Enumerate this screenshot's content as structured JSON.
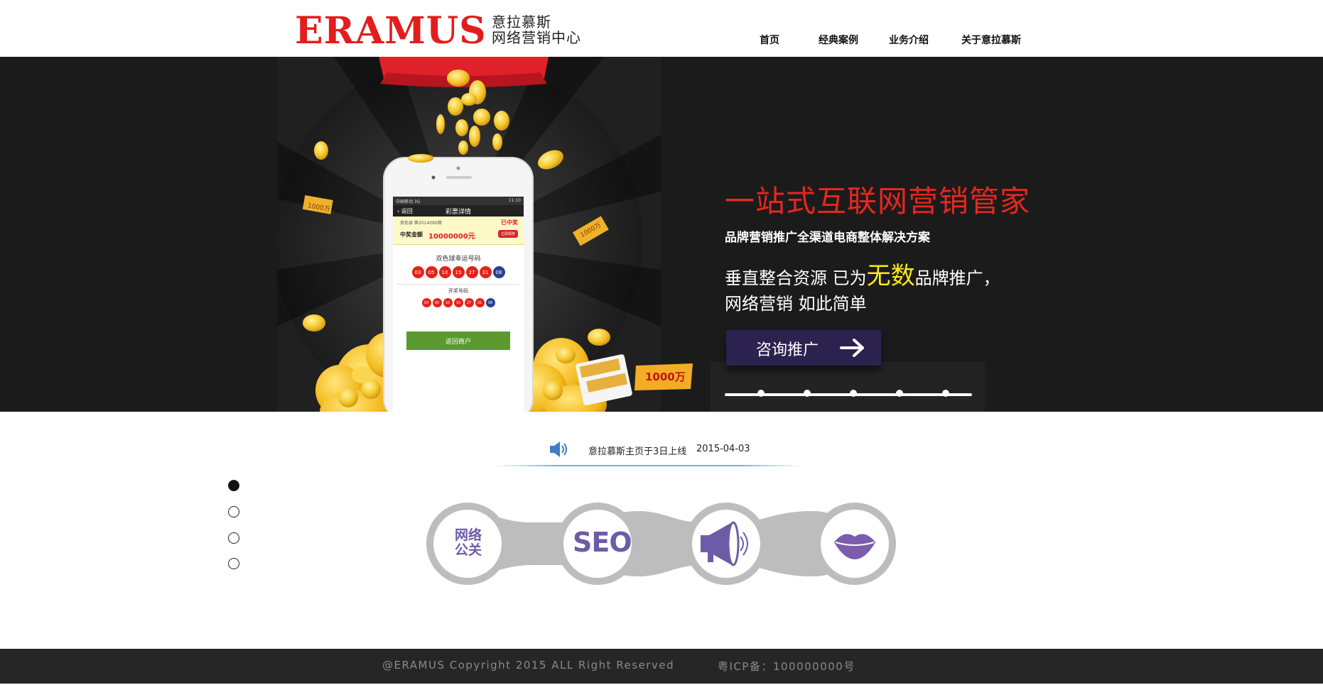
{
  "brand": {
    "logo_word": "ERAMUS",
    "logo_cn_line1": "意拉慕斯",
    "logo_cn_line2": "网络营销中心",
    "primary_color": "#e31d1d"
  },
  "nav": {
    "items": [
      {
        "label": "首页"
      },
      {
        "label": "经典案例"
      },
      {
        "label": "业务介绍"
      },
      {
        "label": "关于意拉慕斯"
      }
    ]
  },
  "banner": {
    "slogan": "一站式互联网营销管家",
    "subline": "品牌营销推广全渠道电商整体解决方案",
    "tagline_part1": "垂直整合资源 已为",
    "tagline_highlight": "无数",
    "tagline_part2": "品牌推广，",
    "tagline_line2": "网络营销 如此简单",
    "cta_label": "咨询推广",
    "slide_count": 5,
    "coin_note_left": "1000万",
    "coin_note_right": "1000万",
    "coin_note_mid": "1000万",
    "highlight_color": "#ffe81c"
  },
  "phone": {
    "status_left": "中国移动 3G",
    "status_right": "11:10",
    "back_label": "返回",
    "title": "彩票详情",
    "issue": "双色球 第2014090期",
    "won_label": "已中奖",
    "amount_label": "中奖金额",
    "amount": "10000000元",
    "claim_label": "立即领奖",
    "lucky_title": "双色球幸运号码",
    "draw_title": "开奖号码",
    "lucky_numbers": [
      "03",
      "05",
      "10",
      "15",
      "27",
      "31"
    ],
    "lucky_blue": "08",
    "draw_numbers": [
      "03",
      "05",
      "10",
      "15",
      "27",
      "31"
    ],
    "draw_blue": "08",
    "return_label": "返回商户"
  },
  "ticker": {
    "icon": "speaker-icon",
    "text": "意拉慕斯主页于3日上线",
    "date": "2015-04-03"
  },
  "side_nav": {
    "count": 4,
    "active_index": 0
  },
  "services": {
    "items": [
      {
        "label_line1": "网络",
        "label_line2": "公关",
        "icon": "pr-text-icon"
      },
      {
        "label": "SEO",
        "icon": "seo-text-icon"
      },
      {
        "icon": "megaphone-icon"
      },
      {
        "icon": "lips-icon"
      }
    ],
    "accent_color": "#6d5ba8"
  },
  "footer": {
    "copyright": "@ERAMUS Copyright 2015 ALL Right Reserved",
    "icp": "粤ICP备：100000000号"
  }
}
